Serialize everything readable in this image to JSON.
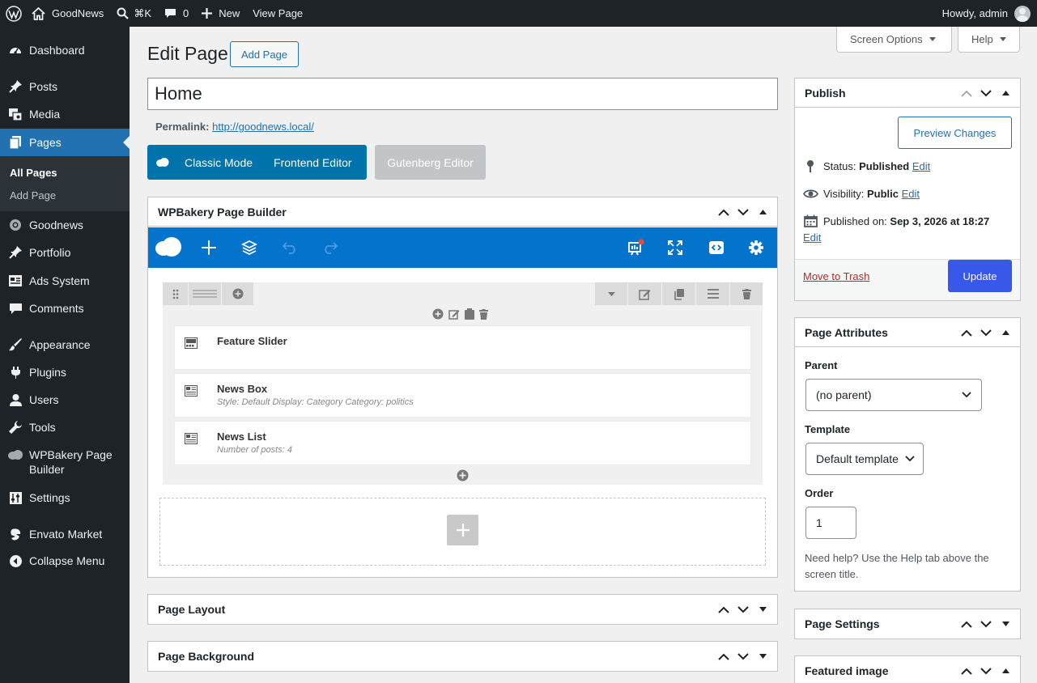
{
  "adminbar": {
    "site_name": "GoodNews",
    "search_shortcut": "⌘K",
    "comments_count": "0",
    "new_label": "New",
    "view_page": "View Page",
    "howdy": "Howdy, admin"
  },
  "sidebar": {
    "items": [
      {
        "label": "Dashboard",
        "icon": "dashboard-icon"
      },
      {
        "label": "Posts",
        "icon": "pin-icon"
      },
      {
        "label": "Media",
        "icon": "media-icon"
      },
      {
        "label": "Pages",
        "icon": "pages-icon"
      },
      {
        "label": "Goodnews",
        "icon": "goodnews-icon"
      },
      {
        "label": "Portfolio",
        "icon": "pin-icon"
      },
      {
        "label": "Ads System",
        "icon": "ads-icon"
      },
      {
        "label": "Comments",
        "icon": "comment-icon"
      },
      {
        "label": "Appearance",
        "icon": "brush-icon"
      },
      {
        "label": "Plugins",
        "icon": "plugin-icon"
      },
      {
        "label": "Users",
        "icon": "user-icon"
      },
      {
        "label": "Tools",
        "icon": "wrench-icon"
      },
      {
        "label": "WPBakery Page Builder",
        "icon": "cloud-icon"
      },
      {
        "label": "Settings",
        "icon": "settings-icon"
      },
      {
        "label": "Envato Market",
        "icon": "envato-icon"
      },
      {
        "label": "Collapse Menu",
        "icon": "collapse-icon"
      }
    ],
    "submenu": [
      "All Pages",
      "Add Page"
    ]
  },
  "header": {
    "title": "Edit Page",
    "add_page": "Add Page",
    "screen_options": "Screen Options",
    "help": "Help"
  },
  "editor": {
    "post_title": "Home",
    "permalink_label": "Permalink:",
    "permalink_url": "http://goodnews.local/",
    "classic_mode": "Classic Mode",
    "frontend_editor": "Frontend Editor",
    "gutenberg_editor": "Gutenberg Editor"
  },
  "wpbakery": {
    "title": "WPBakery Page Builder",
    "elements": [
      {
        "name": "Feature Slider",
        "desc": ""
      },
      {
        "name": "News Box",
        "desc": "Style: Default  Display: Category  Category: politics"
      },
      {
        "name": "News List",
        "desc": "Number of posts: 4"
      }
    ]
  },
  "boxes": {
    "page_layout": "Page Layout",
    "page_background": "Page Background"
  },
  "publish": {
    "title": "Publish",
    "preview": "Preview Changes",
    "status_label": "Status:",
    "status_value": "Published",
    "visibility_label": "Visibility:",
    "visibility_value": "Public",
    "published_label": "Published on:",
    "published_value": "Sep 3, 2026 at 18:27",
    "edit": "Edit",
    "trash": "Move to Trash",
    "update": "Update"
  },
  "attributes": {
    "title": "Page Attributes",
    "parent_label": "Parent",
    "parent_value": "(no parent)",
    "template_label": "Template",
    "template_value": "Default template",
    "order_label": "Order",
    "order_value": "1",
    "help": "Need help? Use the Help tab above the screen title."
  },
  "side_boxes": {
    "page_settings": "Page Settings",
    "featured_image": "Featured image"
  },
  "colors": {
    "accent": "#2271b1",
    "wpbakery_blue": "#0473cc",
    "admin_dark": "#1d2327",
    "update_button": "#3858e9",
    "trash_red": "#b32d2e"
  }
}
